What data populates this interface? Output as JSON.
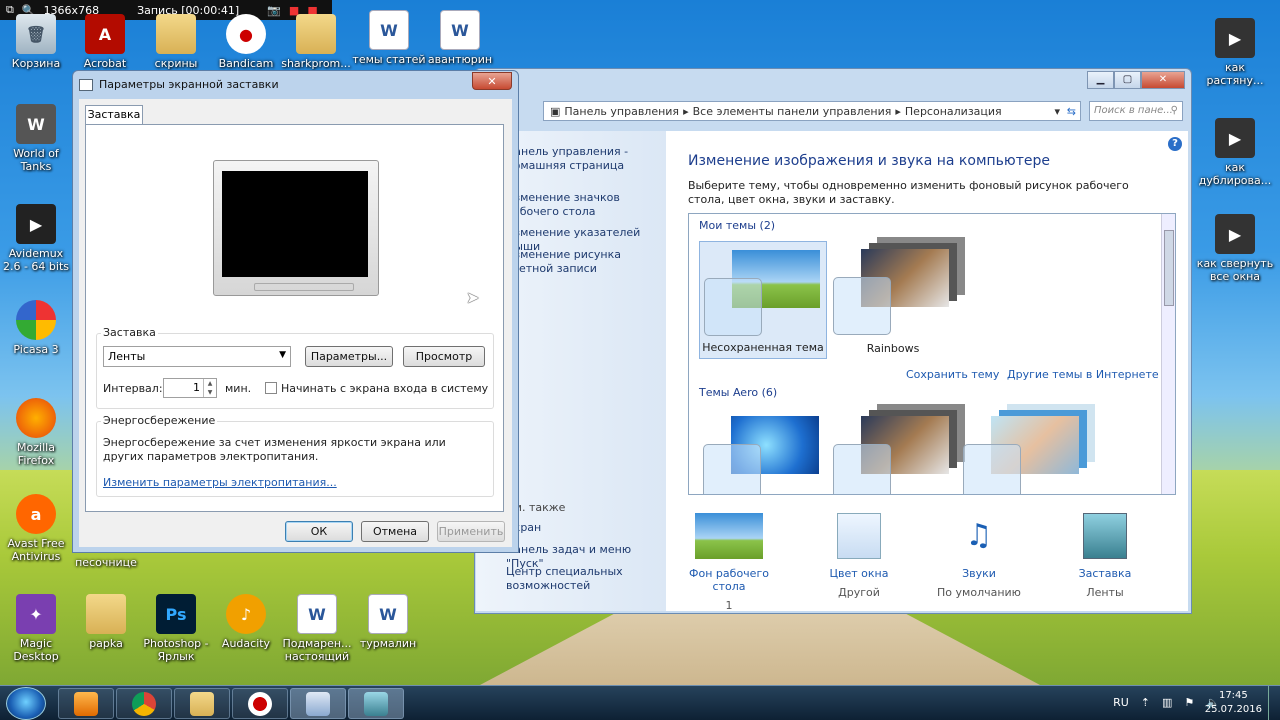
{
  "recorder": {
    "resolution": "1366x768",
    "status": "Запись [00:00:41]"
  },
  "desktop_icons": [
    {
      "label": "Корзина",
      "glyph": "🗑"
    },
    {
      "label": "Acrobat",
      "glyph": "A"
    },
    {
      "label": "скрины",
      "glyph": ""
    },
    {
      "label": "Bandicam",
      "glyph": "●"
    },
    {
      "label": "sharkprom...",
      "glyph": ""
    },
    {
      "label": "темы статей",
      "glyph": "W"
    },
    {
      "label": "авантюрин",
      "glyph": "W"
    },
    {
      "label": "World of Tanks",
      "glyph": "W"
    },
    {
      "label": "Avidemux 2.6 - 64 bits",
      "glyph": "▶"
    },
    {
      "label": "Picasa 3",
      "glyph": ""
    },
    {
      "label": "Mozilla Firefox",
      "glyph": ""
    },
    {
      "label": "Avast Free Antivirus",
      "glyph": "a"
    },
    {
      "label": "песочнице",
      "glyph": ""
    },
    {
      "label": "Magic Desktop",
      "glyph": "✦"
    },
    {
      "label": "papka",
      "glyph": ""
    },
    {
      "label": "Photoshop - Ярлык",
      "glyph": "Ps"
    },
    {
      "label": "Audacity",
      "glyph": "♪"
    },
    {
      "label": "Подмарен... настоящий",
      "glyph": "W"
    },
    {
      "label": "турмалин",
      "glyph": "W"
    },
    {
      "label": "как растяну...",
      "glyph": "▶"
    },
    {
      "label": "как дублирова...",
      "glyph": "▶"
    },
    {
      "label": "как свернуть все окна",
      "glyph": "▶"
    }
  ],
  "personalization": {
    "address": [
      "Панель управления",
      "Все элементы панели управления",
      "Персонализация"
    ],
    "search_placeholder": "Поиск в пане...",
    "left_links": [
      "Панель управления - домашняя страница",
      "Изменение значков рабочего стола",
      "Изменение указателей мыши",
      "Изменение рисунка учетной записи"
    ],
    "see_also": "См. также",
    "see_also_links": [
      "Экран",
      "Панель задач и меню \"Пуск\"",
      "Центр специальных возможностей"
    ],
    "heading": "Изменение изображения и звука на компьютере",
    "description": "Выберите тему, чтобы одновременно изменить фоновый рисунок рабочего стола, цвет окна, звуки и заставку.",
    "my_themes": "Мои темы (2)",
    "theme_unsaved": "Несохраненная тема",
    "theme_rainbows": "Rainbows",
    "save_theme": "Сохранить тему",
    "more_themes": "Другие темы в Интернете",
    "aero_themes": "Темы Aero (6)",
    "bottom": [
      {
        "title": "Фон рабочего стола",
        "value": "1"
      },
      {
        "title": "Цвет окна",
        "value": "Другой"
      },
      {
        "title": "Звуки",
        "value": "По умолчанию"
      },
      {
        "title": "Заставка",
        "value": "Ленты"
      }
    ]
  },
  "dialog": {
    "title": "Параметры экранной заставки",
    "close": "✕",
    "tab": "Заставка",
    "screensaver_group": "Заставка",
    "screensaver_value": "Ленты",
    "params_button": "Параметры...",
    "preview_button": "Просмотр",
    "interval_label": "Интервал:",
    "interval_value": "1",
    "interval_unit": "мин.",
    "logon_checkbox": "Начинать с экрана входа в систему",
    "power_group": "Энергосбережение",
    "power_text": "Энергосбережение за счет изменения яркости экрана или других параметров электропитания.",
    "power_link": "Изменить параметры электропитания...",
    "ok": "ОК",
    "cancel": "Отмена",
    "apply": "Применить"
  },
  "taskbar": {
    "lang": "RU",
    "time": "17:45",
    "date": "25.07.2016"
  },
  "colors": {
    "link": "#1e5ab0",
    "heading": "#1e3f8e",
    "close_red": "#c74a32"
  }
}
